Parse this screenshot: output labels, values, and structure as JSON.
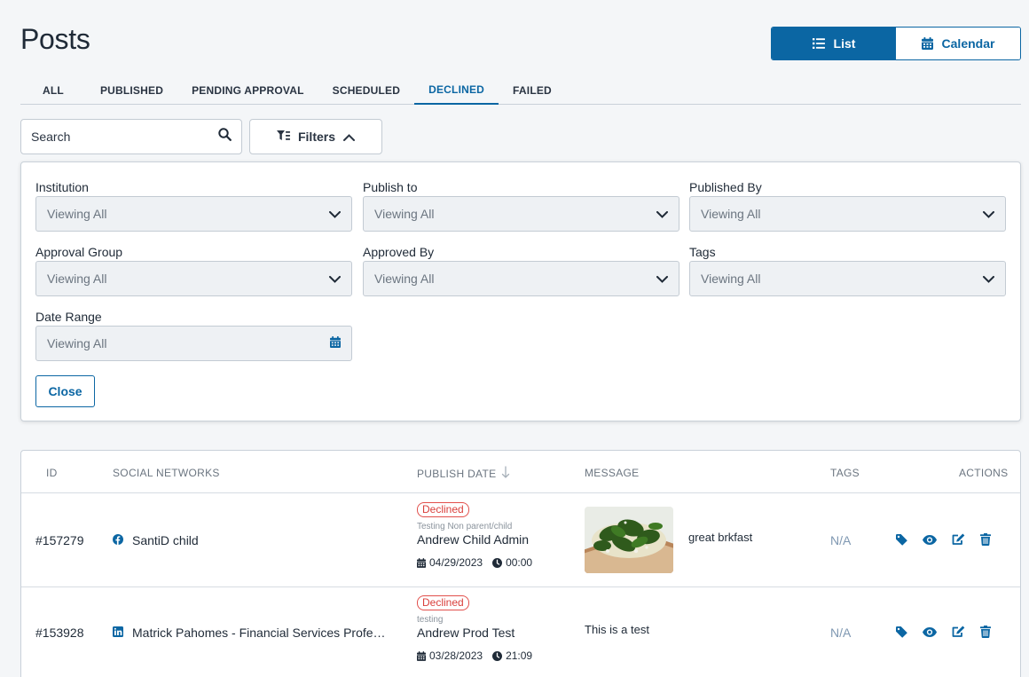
{
  "page": {
    "title": "Posts"
  },
  "view_toggle": {
    "list_label": "List",
    "calendar_label": "Calendar",
    "active": "list"
  },
  "tabs": [
    {
      "label": "ALL"
    },
    {
      "label": "PUBLISHED"
    },
    {
      "label": "PENDING APPROVAL"
    },
    {
      "label": "SCHEDULED"
    },
    {
      "label": "DECLINED",
      "active": true
    },
    {
      "label": "FAILED"
    }
  ],
  "search": {
    "placeholder": "Search",
    "value": ""
  },
  "filters": {
    "button_label": "Filters",
    "fields": [
      {
        "label": "Institution",
        "value": "Viewing All"
      },
      {
        "label": "Publish to",
        "value": "Viewing All"
      },
      {
        "label": "Published By",
        "value": "Viewing All"
      },
      {
        "label": "Approval Group",
        "value": "Viewing All"
      },
      {
        "label": "Approved By",
        "value": "Viewing All"
      },
      {
        "label": "Tags",
        "value": "Viewing All"
      },
      {
        "label": "Date Range",
        "value": "Viewing All"
      }
    ],
    "close_label": "Close"
  },
  "table": {
    "columns": {
      "id": "ID",
      "social_networks": "SOCIAL NETWORKS",
      "publish_date": "PUBLISH DATE",
      "message": "MESSAGE",
      "tags": "TAGS",
      "actions": "ACTIONS"
    },
    "rows": [
      {
        "id": "#157279",
        "network_icon": "facebook-icon",
        "network_name": "SantiD child",
        "status": "Declined",
        "group": "Testing Non parent/child",
        "author": "Andrew Child Admin",
        "date": "04/29/2023",
        "time": "00:00",
        "has_image": true,
        "message": "great brkfast",
        "tags": "N/A"
      },
      {
        "id": "#153928",
        "network_icon": "linkedin-icon",
        "network_name": "Matrick Pahomes - Financial Services Professio...",
        "status": "Declined",
        "group": "testing",
        "author": "Andrew Prod Test",
        "date": "03/28/2023",
        "time": "21:09",
        "has_image": false,
        "message": "This is a test",
        "tags": "N/A"
      }
    ]
  },
  "colors": {
    "brand_blue": "#0b66a3",
    "declined_red": "#d93f3b",
    "facebook_blue": "#1877f2",
    "linkedin_blue": "#0a66c2"
  }
}
